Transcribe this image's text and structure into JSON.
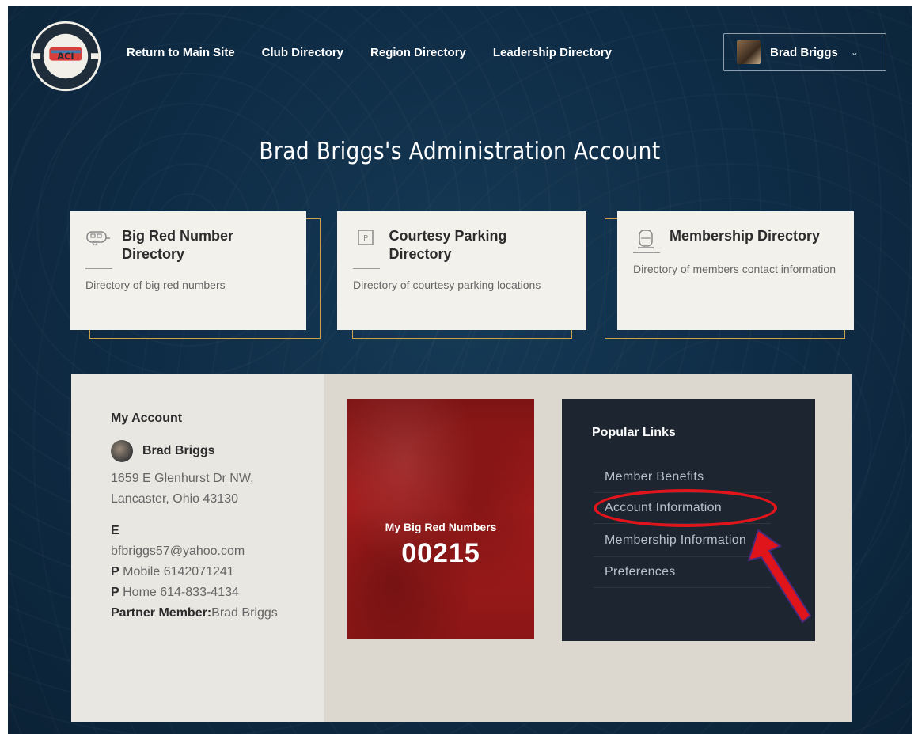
{
  "header": {
    "nav": [
      "Return to Main Site",
      "Club Directory",
      "Region Directory",
      "Leadership Directory"
    ],
    "user_name": "Brad Briggs"
  },
  "logo": {
    "top_text": "AIRSTREAM CLUB",
    "bottom_text": "INTERNATIONAL",
    "monogram": "ACI"
  },
  "title": "Brad Briggs's Administration Account",
  "cards": [
    {
      "title": "Big Red Number Directory",
      "icon": "airstream-trailer-icon",
      "desc": "Directory of big red numbers"
    },
    {
      "title": "Courtesy Parking Directory",
      "icon": "parking-sign-icon",
      "desc": "Directory of courtesy parking locations"
    },
    {
      "title": "Membership Directory",
      "icon": "member-badge-icon",
      "desc": "Directory of members contact information"
    }
  ],
  "account": {
    "heading": "My Account",
    "name": "Brad Briggs",
    "address_line1": "1659 E Glenhurst Dr NW,",
    "address_line2": "Lancaster, Ohio 43130",
    "email_label": "E",
    "email": "bfbriggs57@yahoo.com",
    "mobile_label": "P",
    "mobile": "Mobile 6142071241",
    "home_label": "P",
    "home": "Home 614-833-4134",
    "partner_label": "Partner Member:",
    "partner": "Brad Briggs"
  },
  "big_red": {
    "label": "My Big Red Numbers",
    "number": "00215"
  },
  "popular_links": {
    "heading": "Popular Links",
    "items": [
      "Member Benefits",
      "Account Information",
      "Membership Information",
      "Preferences"
    ]
  },
  "colors": {
    "background": "#0f2d47",
    "card_border": "#c9a24a",
    "big_red": "#a51b1b",
    "links_panel": "#1c2530",
    "annotation": "#e0141b"
  }
}
